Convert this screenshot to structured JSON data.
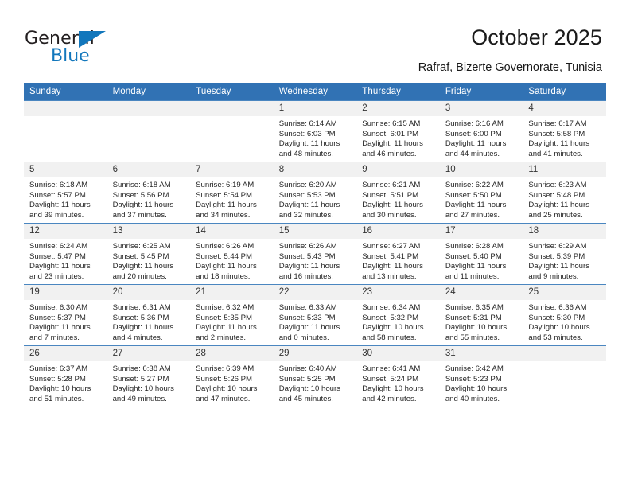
{
  "logo": {
    "word_one": "General",
    "word_two": "Blue",
    "triangle_color": "#1277bc"
  },
  "header": {
    "title": "October 2025",
    "location": "Rafraf, Bizerte Governorate, Tunisia",
    "accent_color": "#3172b4"
  },
  "calendar": {
    "weekday_headers": [
      "Sunday",
      "Monday",
      "Tuesday",
      "Wednesday",
      "Thursday",
      "Friday",
      "Saturday"
    ],
    "weeks": [
      [
        {
          "day": "",
          "sunrise": "",
          "sunset": "",
          "daylight": ""
        },
        {
          "day": "",
          "sunrise": "",
          "sunset": "",
          "daylight": ""
        },
        {
          "day": "",
          "sunrise": "",
          "sunset": "",
          "daylight": ""
        },
        {
          "day": "1",
          "sunrise": "Sunrise: 6:14 AM",
          "sunset": "Sunset: 6:03 PM",
          "daylight": "Daylight: 11 hours and 48 minutes."
        },
        {
          "day": "2",
          "sunrise": "Sunrise: 6:15 AM",
          "sunset": "Sunset: 6:01 PM",
          "daylight": "Daylight: 11 hours and 46 minutes."
        },
        {
          "day": "3",
          "sunrise": "Sunrise: 6:16 AM",
          "sunset": "Sunset: 6:00 PM",
          "daylight": "Daylight: 11 hours and 44 minutes."
        },
        {
          "day": "4",
          "sunrise": "Sunrise: 6:17 AM",
          "sunset": "Sunset: 5:58 PM",
          "daylight": "Daylight: 11 hours and 41 minutes."
        }
      ],
      [
        {
          "day": "5",
          "sunrise": "Sunrise: 6:18 AM",
          "sunset": "Sunset: 5:57 PM",
          "daylight": "Daylight: 11 hours and 39 minutes."
        },
        {
          "day": "6",
          "sunrise": "Sunrise: 6:18 AM",
          "sunset": "Sunset: 5:56 PM",
          "daylight": "Daylight: 11 hours and 37 minutes."
        },
        {
          "day": "7",
          "sunrise": "Sunrise: 6:19 AM",
          "sunset": "Sunset: 5:54 PM",
          "daylight": "Daylight: 11 hours and 34 minutes."
        },
        {
          "day": "8",
          "sunrise": "Sunrise: 6:20 AM",
          "sunset": "Sunset: 5:53 PM",
          "daylight": "Daylight: 11 hours and 32 minutes."
        },
        {
          "day": "9",
          "sunrise": "Sunrise: 6:21 AM",
          "sunset": "Sunset: 5:51 PM",
          "daylight": "Daylight: 11 hours and 30 minutes."
        },
        {
          "day": "10",
          "sunrise": "Sunrise: 6:22 AM",
          "sunset": "Sunset: 5:50 PM",
          "daylight": "Daylight: 11 hours and 27 minutes."
        },
        {
          "day": "11",
          "sunrise": "Sunrise: 6:23 AM",
          "sunset": "Sunset: 5:48 PM",
          "daylight": "Daylight: 11 hours and 25 minutes."
        }
      ],
      [
        {
          "day": "12",
          "sunrise": "Sunrise: 6:24 AM",
          "sunset": "Sunset: 5:47 PM",
          "daylight": "Daylight: 11 hours and 23 minutes."
        },
        {
          "day": "13",
          "sunrise": "Sunrise: 6:25 AM",
          "sunset": "Sunset: 5:45 PM",
          "daylight": "Daylight: 11 hours and 20 minutes."
        },
        {
          "day": "14",
          "sunrise": "Sunrise: 6:26 AM",
          "sunset": "Sunset: 5:44 PM",
          "daylight": "Daylight: 11 hours and 18 minutes."
        },
        {
          "day": "15",
          "sunrise": "Sunrise: 6:26 AM",
          "sunset": "Sunset: 5:43 PM",
          "daylight": "Daylight: 11 hours and 16 minutes."
        },
        {
          "day": "16",
          "sunrise": "Sunrise: 6:27 AM",
          "sunset": "Sunset: 5:41 PM",
          "daylight": "Daylight: 11 hours and 13 minutes."
        },
        {
          "day": "17",
          "sunrise": "Sunrise: 6:28 AM",
          "sunset": "Sunset: 5:40 PM",
          "daylight": "Daylight: 11 hours and 11 minutes."
        },
        {
          "day": "18",
          "sunrise": "Sunrise: 6:29 AM",
          "sunset": "Sunset: 5:39 PM",
          "daylight": "Daylight: 11 hours and 9 minutes."
        }
      ],
      [
        {
          "day": "19",
          "sunrise": "Sunrise: 6:30 AM",
          "sunset": "Sunset: 5:37 PM",
          "daylight": "Daylight: 11 hours and 7 minutes."
        },
        {
          "day": "20",
          "sunrise": "Sunrise: 6:31 AM",
          "sunset": "Sunset: 5:36 PM",
          "daylight": "Daylight: 11 hours and 4 minutes."
        },
        {
          "day": "21",
          "sunrise": "Sunrise: 6:32 AM",
          "sunset": "Sunset: 5:35 PM",
          "daylight": "Daylight: 11 hours and 2 minutes."
        },
        {
          "day": "22",
          "sunrise": "Sunrise: 6:33 AM",
          "sunset": "Sunset: 5:33 PM",
          "daylight": "Daylight: 11 hours and 0 minutes."
        },
        {
          "day": "23",
          "sunrise": "Sunrise: 6:34 AM",
          "sunset": "Sunset: 5:32 PM",
          "daylight": "Daylight: 10 hours and 58 minutes."
        },
        {
          "day": "24",
          "sunrise": "Sunrise: 6:35 AM",
          "sunset": "Sunset: 5:31 PM",
          "daylight": "Daylight: 10 hours and 55 minutes."
        },
        {
          "day": "25",
          "sunrise": "Sunrise: 6:36 AM",
          "sunset": "Sunset: 5:30 PM",
          "daylight": "Daylight: 10 hours and 53 minutes."
        }
      ],
      [
        {
          "day": "26",
          "sunrise": "Sunrise: 6:37 AM",
          "sunset": "Sunset: 5:28 PM",
          "daylight": "Daylight: 10 hours and 51 minutes."
        },
        {
          "day": "27",
          "sunrise": "Sunrise: 6:38 AM",
          "sunset": "Sunset: 5:27 PM",
          "daylight": "Daylight: 10 hours and 49 minutes."
        },
        {
          "day": "28",
          "sunrise": "Sunrise: 6:39 AM",
          "sunset": "Sunset: 5:26 PM",
          "daylight": "Daylight: 10 hours and 47 minutes."
        },
        {
          "day": "29",
          "sunrise": "Sunrise: 6:40 AM",
          "sunset": "Sunset: 5:25 PM",
          "daylight": "Daylight: 10 hours and 45 minutes."
        },
        {
          "day": "30",
          "sunrise": "Sunrise: 6:41 AM",
          "sunset": "Sunset: 5:24 PM",
          "daylight": "Daylight: 10 hours and 42 minutes."
        },
        {
          "day": "31",
          "sunrise": "Sunrise: 6:42 AM",
          "sunset": "Sunset: 5:23 PM",
          "daylight": "Daylight: 10 hours and 40 minutes."
        },
        {
          "day": "",
          "sunrise": "",
          "sunset": "",
          "daylight": ""
        }
      ]
    ]
  }
}
